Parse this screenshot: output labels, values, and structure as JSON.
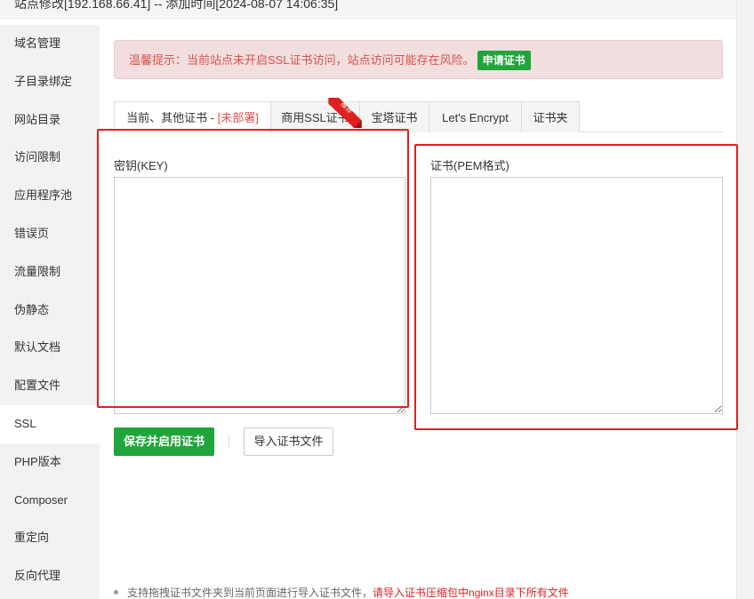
{
  "title": "站点修改[192.168.66.41] -- 添加时间[2024-08-07 14:06:35]",
  "sidebar": {
    "items": [
      {
        "label": "域名管理"
      },
      {
        "label": "子目录绑定"
      },
      {
        "label": "网站目录"
      },
      {
        "label": "访问限制"
      },
      {
        "label": "应用程序池"
      },
      {
        "label": "错误页"
      },
      {
        "label": "流量限制"
      },
      {
        "label": "伪静态"
      },
      {
        "label": "默认文档"
      },
      {
        "label": "配置文件"
      },
      {
        "label": "SSL"
      },
      {
        "label": "PHP版本"
      },
      {
        "label": "Composer"
      },
      {
        "label": "重定向"
      },
      {
        "label": "反向代理"
      }
    ],
    "active": "SSL"
  },
  "alert": {
    "text": "温馨提示：当前站点未开启SSL证书访问，站点访问可能存在风险。",
    "button": "申请证书"
  },
  "tabs": {
    "current": {
      "label": "当前、其他证书 - ",
      "status": "[未部署]"
    },
    "commercial": "商用SSL证书",
    "baota": "宝塔证书",
    "letsencrypt": "Let's Encrypt",
    "folder": "证书夹",
    "ribbon": "推荐"
  },
  "form": {
    "key_label": "密钥(KEY)",
    "key_value": "",
    "cert_label": "证书(PEM格式)",
    "cert_value": ""
  },
  "actions": {
    "save": "保存并启用证书",
    "import": "导入证书文件"
  },
  "tip": {
    "text": "支持拖拽证书文件夹到当前页面进行导入证书文件，",
    "highlight": "请导入证书压缩包中nginx目录下所有文件"
  },
  "colors": {
    "accent": "#20a53a",
    "danger": "#d9534f",
    "highlight_box": "#e02020"
  }
}
